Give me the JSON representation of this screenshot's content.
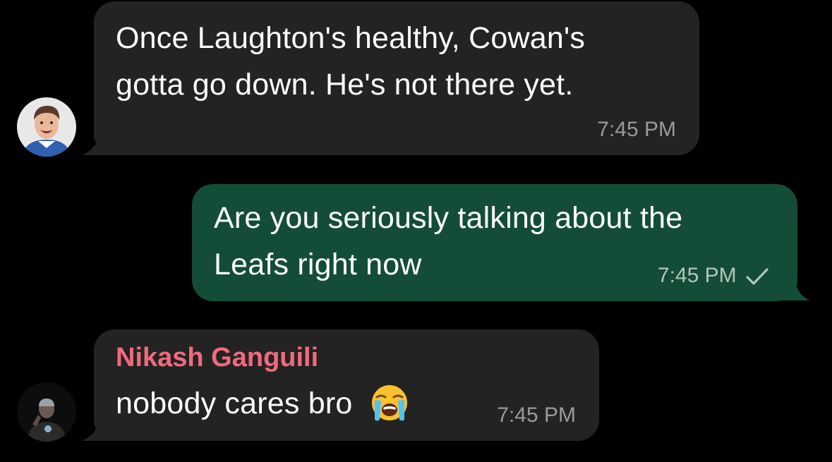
{
  "messages": [
    {
      "direction": "incoming",
      "lines": [
        "Once Laughton's healthy, Cowan's",
        "gotta go down. He's not there yet."
      ],
      "time": "7:45 PM",
      "avatar": "person-smiling"
    },
    {
      "direction": "outgoing",
      "lines": [
        "Are you seriously talking about the",
        "Leafs right now"
      ],
      "time": "7:45 PM",
      "status_icon": "check-icon"
    },
    {
      "direction": "incoming",
      "sender": "Nikash Ganguili",
      "text": "nobody cares bro",
      "emoji": "loudly-crying-face",
      "time": "7:45 PM",
      "avatar": "person-dark-photo"
    }
  ],
  "colors": {
    "background": "#000000",
    "incoming_bubble": "#232323",
    "outgoing_bubble": "#144d37",
    "sender_name": "#f06a7e",
    "timestamp": "#9a9a9a"
  }
}
